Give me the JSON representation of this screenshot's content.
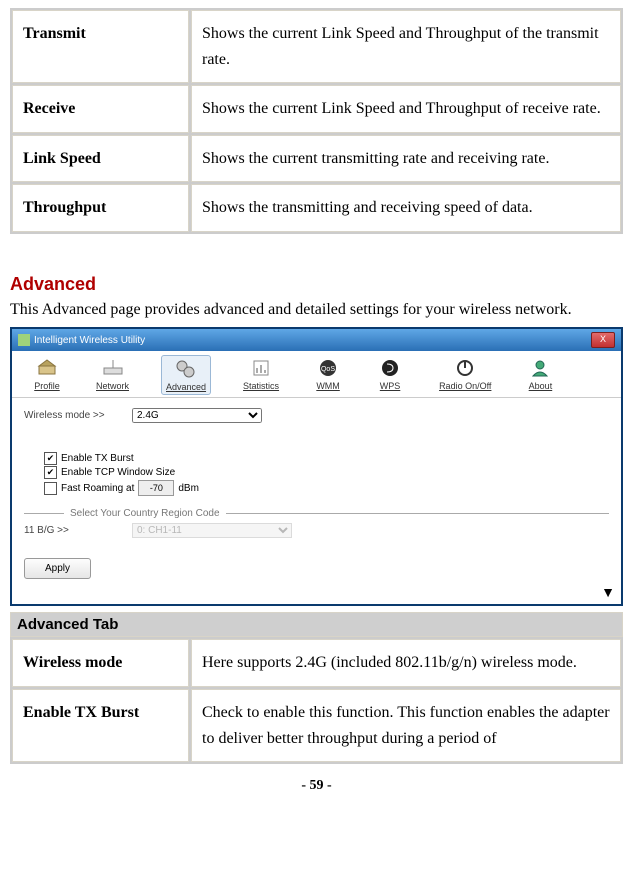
{
  "table1": {
    "rows": [
      {
        "key": "Transmit",
        "val": "Shows the current Link Speed and Throughput of the transmit rate."
      },
      {
        "key": "Receive",
        "val": "Shows the current Link Speed and Throughput of receive rate."
      },
      {
        "key": "Link Speed",
        "val": "Shows the current transmitting rate and receiving rate."
      },
      {
        "key": "Throughput",
        "val": "Shows the transmitting and receiving speed of data."
      }
    ]
  },
  "section": {
    "heading": "Advanced",
    "intro": "This Advanced page provides advanced and detailed settings for your wireless network."
  },
  "app": {
    "title": "Intelligent Wireless Utility",
    "close": "X",
    "tabs": {
      "profile": "Profile",
      "network": "Network",
      "advanced": "Advanced",
      "statistics": "Statistics",
      "wmm": "WMM",
      "wps": "WPS",
      "radio": "Radio On/Off",
      "about": "About"
    },
    "wireless_mode_label": "Wireless mode >>",
    "wireless_mode_value": "2.4G",
    "enable_tx_burst": "Enable TX Burst",
    "enable_tcp_window": "Enable TCP Window Size",
    "fast_roaming_label": "Fast Roaming at",
    "fast_roaming_value": "-70",
    "dbm": "dBm",
    "region_label": "Select Your Country Region Code",
    "bgn_label": "11 B/G >>",
    "region_value": "0: CH1-11",
    "apply": "Apply"
  },
  "table2": {
    "header": "Advanced Tab",
    "rows": [
      {
        "key": "Wireless mode",
        "val": "Here supports 2.4G (included 802.11b/g/n) wireless mode."
      },
      {
        "key": "Enable TX Burst",
        "val": "Check to enable this function. This function enables the adapter to deliver better throughput during a period of"
      }
    ]
  },
  "page_number": "- 59 -"
}
